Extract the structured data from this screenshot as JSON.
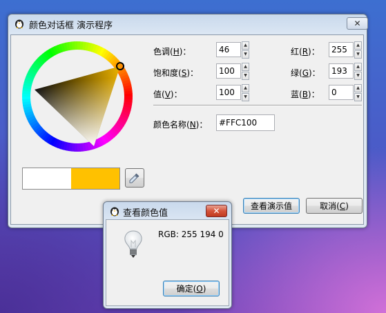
{
  "main_dialog": {
    "title": "颜色对话框 演示程序",
    "close_label": "✕",
    "hue_label_prefix": "色调(",
    "hue_label_key": "H",
    "hue_label_suffix": ")：",
    "hue_value": "46",
    "saturation_label_prefix": "饱和度(",
    "saturation_label_key": "S",
    "saturation_label_suffix": ")：",
    "saturation_value": "100",
    "value_label_prefix": "值(",
    "value_label_key": "V",
    "value_label_suffix": ")：",
    "value_value": "100",
    "red_label_prefix": "红(",
    "red_label_key": "R",
    "red_label_suffix": ")：",
    "red_value": "255",
    "green_label_prefix": "绿(",
    "green_label_key": "G",
    "green_label_suffix": ")：",
    "green_value": "193",
    "blue_label_prefix": "蓝(",
    "blue_label_key": "B",
    "blue_label_suffix": ")：",
    "blue_value": "0",
    "color_name_label_prefix": "颜色名称(",
    "color_name_label_key": "N",
    "color_name_label_suffix": ")：",
    "color_name_value": "#FFC100",
    "preview_old_color": "#ffffff",
    "preview_new_color": "#ffc100",
    "eyedropper_icon": "eyedropper-icon",
    "view_button_label": "查看演示值",
    "cancel_button_prefix": "取消(",
    "cancel_button_key": "C",
    "cancel_button_suffix": ")"
  },
  "info_dialog": {
    "title": "查看颜色值",
    "close_label": "✕",
    "message": "RGB: 255 194 0",
    "bulb_icon": "lightbulb-icon",
    "ok_button_prefix": "确定(",
    "ok_button_key": "O",
    "ok_button_suffix": ")"
  }
}
